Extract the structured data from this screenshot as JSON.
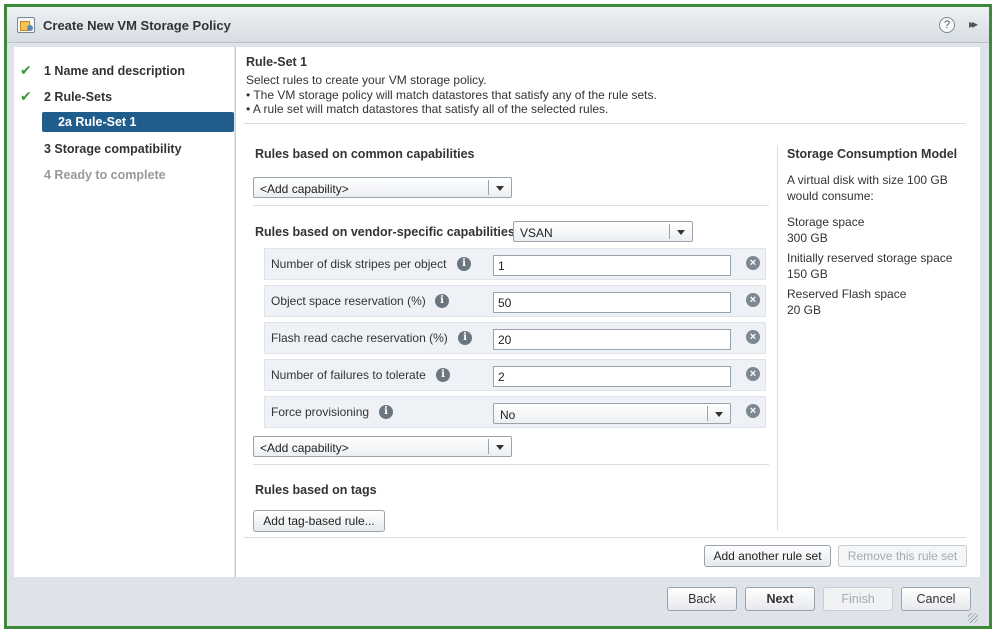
{
  "window": {
    "title": "Create New VM Storage Policy",
    "help_glyph": "?",
    "expand_glyph": "▸▸"
  },
  "sidebar": {
    "items": [
      {
        "check": "✔",
        "label": "1  Name and description"
      },
      {
        "check": "✔",
        "label": "2  Rule-Sets"
      },
      {
        "label": "2a  Rule-Set 1"
      },
      {
        "label": "3  Storage compatibility"
      },
      {
        "label": "4  Ready to complete"
      }
    ]
  },
  "ruleset": {
    "title": "Rule-Set 1",
    "desc1": "Select rules to create your VM storage policy.",
    "desc2": "• The VM storage policy will match datastores that satisfy any of the rule sets.",
    "desc3": "• A rule set will match datastores that satisfy all of the selected rules."
  },
  "common": {
    "title": "Rules based on common capabilities",
    "add_capability": "<Add capability>"
  },
  "vendor": {
    "title": "Rules based on vendor-specific capabilities",
    "provider": "VSAN",
    "rules": [
      {
        "label": "Number of disk stripes per object",
        "value": "1"
      },
      {
        "label": "Object space reservation (%)",
        "value": "50"
      },
      {
        "label": "Flash read cache reservation (%)",
        "value": "20"
      },
      {
        "label": "Number of failures to tolerate",
        "value": "2"
      },
      {
        "label": "Force provisioning",
        "value": "No"
      }
    ],
    "add_capability": "<Add capability>",
    "info_glyph": "i",
    "remove_glyph": "×"
  },
  "tags": {
    "title": "Rules based on tags",
    "add_button": "Add tag-based rule..."
  },
  "consumption": {
    "title": "Storage Consumption Model",
    "intro1": "A virtual disk with size 100 GB",
    "intro2": "would consume:",
    "storage_label": "Storage space",
    "storage_value": "300 GB",
    "reserved_label": "Initially reserved storage space",
    "reserved_value": "150 GB",
    "flash_label": "Reserved Flash space",
    "flash_value": "20 GB"
  },
  "ruleset_actions": {
    "add": "Add another rule set",
    "remove": "Remove this rule set"
  },
  "footer": {
    "back": "Back",
    "next": "Next",
    "finish": "Finish",
    "cancel": "Cancel"
  },
  "colors": {
    "frame_border": "#3d8a3a",
    "active_step": "#1f5d8c",
    "check": "#3c9a3a"
  }
}
